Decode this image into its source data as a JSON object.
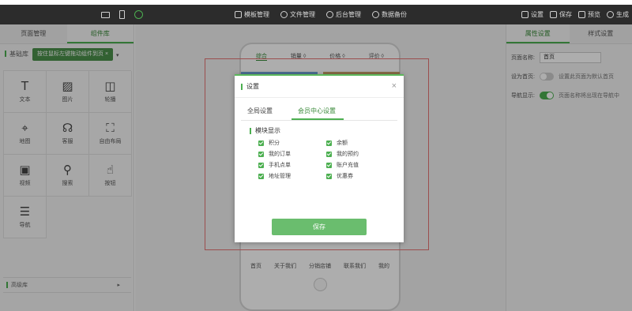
{
  "topbar": {
    "nav": [
      {
        "label": "模板管理",
        "icon": "grid-icon"
      },
      {
        "label": "文件管理",
        "icon": "person-icon"
      },
      {
        "label": "后台管理",
        "icon": "gear-icon"
      },
      {
        "label": "数据备份",
        "icon": "cloud-icon"
      }
    ],
    "actions": [
      {
        "label": "设置",
        "icon": "settings-icon"
      },
      {
        "label": "保存",
        "icon": "save-icon"
      },
      {
        "label": "预览",
        "icon": "preview-icon"
      },
      {
        "label": "生成",
        "icon": "generate-icon"
      }
    ]
  },
  "left_panel": {
    "tabs": [
      "页面管理",
      "组件库"
    ],
    "basic_lib": "基础库",
    "tooltip": "按住鼠标左键拖动组件到页",
    "tooltip_close": "×",
    "arrow": "▾",
    "components": [
      {
        "label": "文本",
        "icon": "text-icon",
        "glyph": "T"
      },
      {
        "label": "图片",
        "icon": "image-icon",
        "glyph": "▨"
      },
      {
        "label": "轮播",
        "icon": "carousel-icon",
        "glyph": "◫"
      },
      {
        "label": "地图",
        "icon": "map-pin-icon",
        "glyph": "⌖"
      },
      {
        "label": "客服",
        "icon": "headset-icon",
        "glyph": "☊"
      },
      {
        "label": "自由布局",
        "icon": "free-layout-icon",
        "glyph": "⛶"
      },
      {
        "label": "视频",
        "icon": "video-icon",
        "glyph": "▣"
      },
      {
        "label": "搜索",
        "icon": "search-icon",
        "glyph": "⚲"
      },
      {
        "label": "按钮",
        "icon": "tap-icon",
        "glyph": "☝"
      },
      {
        "label": "导航",
        "icon": "nav-list-icon",
        "glyph": "☰"
      }
    ],
    "advanced_lib": "高级库",
    "advanced_arrow": "▸"
  },
  "phone": {
    "sort": [
      "综合",
      "销量 ◊",
      "价格 ◊",
      "评价 ◊"
    ],
    "footer": [
      "首页",
      "关于我们",
      "分销店铺",
      "联系我们",
      "我的"
    ]
  },
  "right_panel": {
    "tabs": [
      "属性设置",
      "样式设置"
    ],
    "page_name_label": "页面名称:",
    "page_name_value": "首页",
    "homepage_label": "设为首页:",
    "homepage_hint": "设置此页面为默认首页",
    "nav_label": "导航显示:",
    "nav_hint": "页面名称将出现在导航中"
  },
  "modal": {
    "title": "设置",
    "close": "×",
    "tabs": [
      "全局设置",
      "会员中心设置"
    ],
    "section_title": "模块显示",
    "options": [
      "积分",
      "余额",
      "我的订单",
      "我的预约",
      "手机点单",
      "账户充值",
      "地址管理",
      "优惠券"
    ],
    "save_label": "保存"
  },
  "colors": {
    "accent": "#4caf50",
    "topbar": "#2c2c2c",
    "frame": "#e57373"
  }
}
